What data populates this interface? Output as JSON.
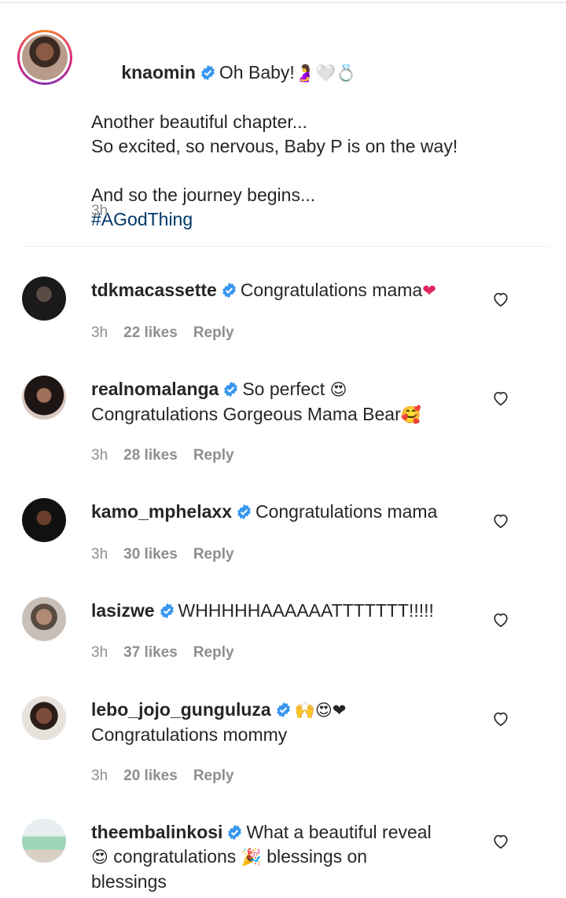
{
  "caption": {
    "username": "knaomin",
    "line1": "Oh Baby!",
    "line1_emoji": "🤰🤍💍",
    "line2": "Another beautiful chapter...",
    "line3": "So excited, so nervous, Baby P is on the way!",
    "line4": "",
    "line5": "And so the journey begins...",
    "hashtag": "#AGodThing",
    "time": "3h"
  },
  "comments": [
    {
      "username": "tdkmacassette",
      "text": "Congratulations mama",
      "emoji": "❤",
      "time": "3h",
      "likes": "22 likes",
      "reply": "Reply"
    },
    {
      "username": "realnomalanga",
      "text": "So perfect",
      "emoji": "😍",
      "text2": "Congratulations Gorgeous Mama Bear",
      "emoji2": "🥰",
      "time": "3h",
      "likes": "28 likes",
      "reply": "Reply"
    },
    {
      "username": "kamo_mphelaxx",
      "text": "Congratulations mama",
      "time": "3h",
      "likes": "30 likes",
      "reply": "Reply"
    },
    {
      "username": "lasizwe",
      "text": "WHHHHHAAAAAATTTTTTT!!!!!",
      "time": "3h",
      "likes": "37 likes",
      "reply": "Reply"
    },
    {
      "username": "lebo_jojo_gunguluza",
      "emoji": "🙌😍❤",
      "text2": "Congratulations mommy",
      "time": "3h",
      "likes": "20 likes",
      "reply": "Reply"
    },
    {
      "username": "theembalinkosi",
      "text": "What a beautiful reveal",
      "emoji": "😍",
      "text2": "congratulations",
      "emoji2": "🎉",
      "text3": "blessings on",
      "text4": "blessings"
    }
  ],
  "colors": {
    "verified": "#3897f0",
    "hashtag": "#00376b",
    "meta": "#8e8e8e"
  }
}
